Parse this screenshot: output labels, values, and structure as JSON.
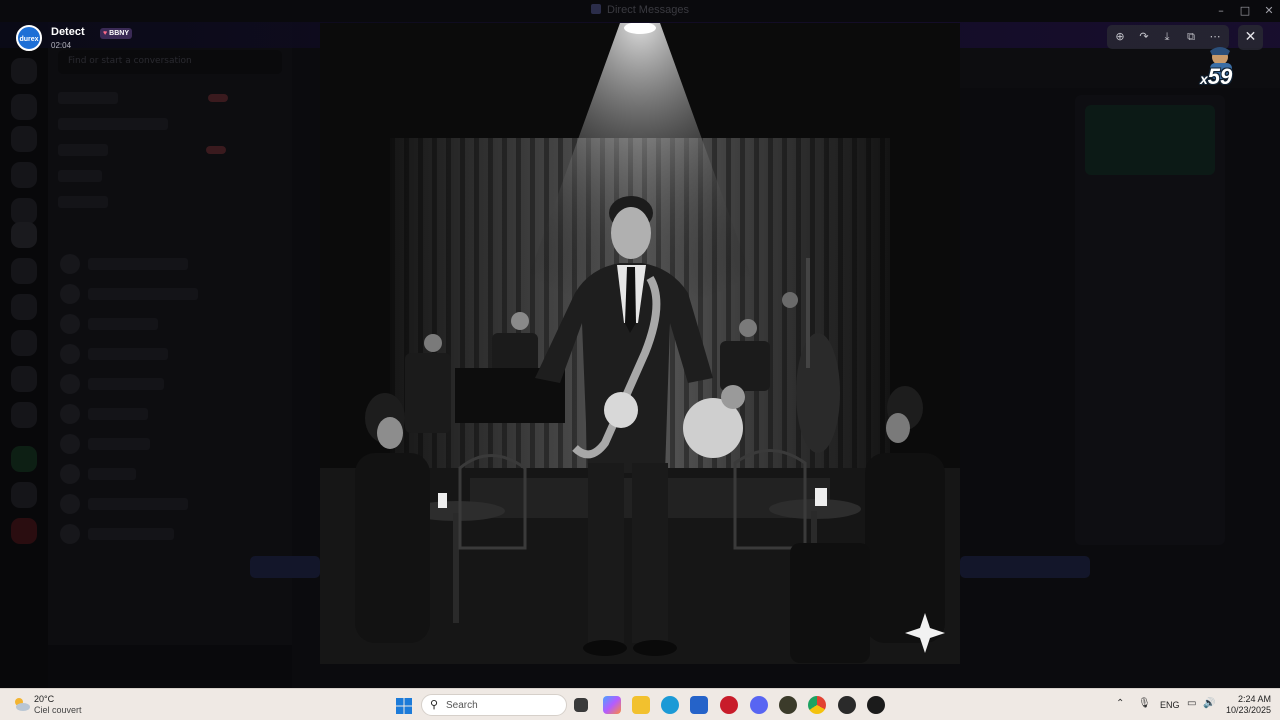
{
  "window": {
    "title": "Direct Messages",
    "minimize_icon": "minimize-icon",
    "maximize_icon": "maximize-icon",
    "close_icon": "close-icon"
  },
  "background": {
    "search_placeholder": "Find or start a conversation"
  },
  "viewer": {
    "author_name": "Detect",
    "author_tag": "BBNY",
    "timestamp": "02:04",
    "avatar_text": "durex",
    "toolbar": [
      {
        "name": "zoom-in-icon",
        "glyph": "⊕"
      },
      {
        "name": "forward-icon",
        "glyph": "↷"
      },
      {
        "name": "download-icon",
        "glyph": "⤓"
      },
      {
        "name": "open-external-icon",
        "glyph": "⧉"
      },
      {
        "name": "more-icon",
        "glyph": "⋯"
      }
    ],
    "close_glyph": "✕",
    "sticker_count": "59",
    "sticker_prefix": "x"
  },
  "taskbar": {
    "weather_temp": "20°C",
    "weather_condition": "Ciel couvert",
    "search_placeholder": "Search",
    "language": "ENG",
    "time": "2:24 AM",
    "date": "10/23/2025",
    "apps": [
      {
        "name": "task-view-icon",
        "color": "#3a3a3a"
      },
      {
        "name": "copilot-icon",
        "color": "#7b61ff"
      },
      {
        "name": "file-explorer-icon",
        "color": "#f2c12e"
      },
      {
        "name": "edge-icon",
        "color": "#1b9ad6"
      },
      {
        "name": "store-icon",
        "color": "#2563c9"
      },
      {
        "name": "app-red-icon",
        "color": "#c81c2a"
      },
      {
        "name": "discord-icon",
        "color": "#5865f2"
      },
      {
        "name": "app-gold-icon",
        "color": "#3b3b2a"
      },
      {
        "name": "chrome-icon",
        "color": "#e24233"
      },
      {
        "name": "app-dark-icon",
        "color": "#2a2a2a"
      },
      {
        "name": "media-player-icon",
        "color": "#1b1b1b"
      }
    ]
  }
}
